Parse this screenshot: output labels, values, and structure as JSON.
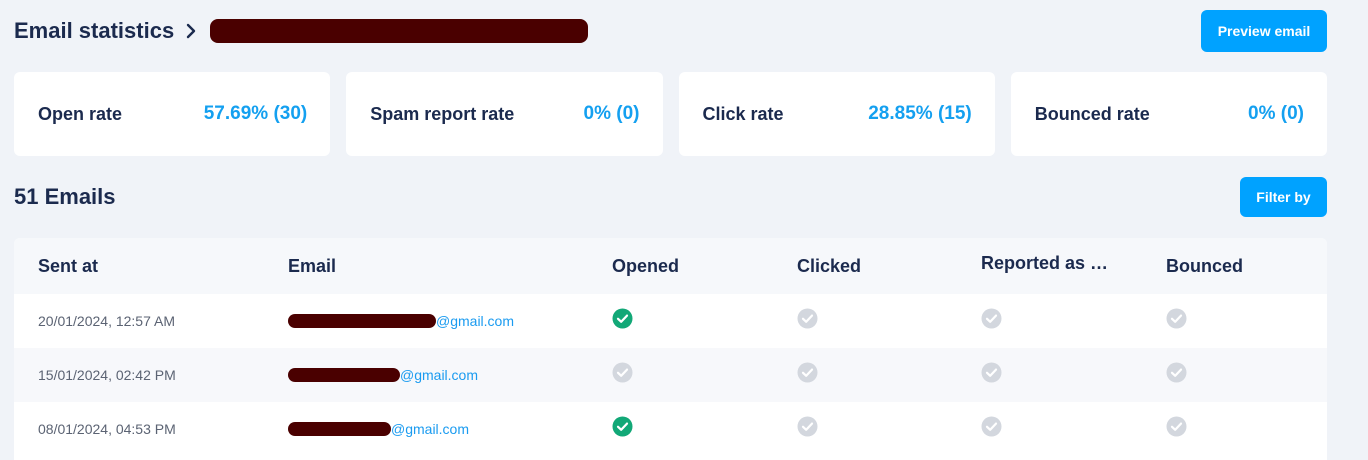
{
  "header": {
    "title": "Email statistics",
    "preview_button": "Preview email"
  },
  "stats": [
    {
      "label": "Open rate",
      "value": "57.69% (30)"
    },
    {
      "label": "Spam report rate",
      "value": "0% (0)"
    },
    {
      "label": "Click rate",
      "value": "28.85% (15)"
    },
    {
      "label": "Bounced rate",
      "value": "0% (0)"
    }
  ],
  "list": {
    "title": "51 Emails",
    "filter_button": "Filter by"
  },
  "table": {
    "columns": [
      "Sent at",
      "Email",
      "Opened",
      "Clicked",
      "Reported as s…",
      "Bounced"
    ],
    "rows": [
      {
        "sent_at": "20/01/2024, 12:57 AM",
        "email_domain": "@gmail.com",
        "opened": true,
        "clicked": false,
        "reported": false,
        "bounced": false
      },
      {
        "sent_at": "15/01/2024, 02:42 PM",
        "email_domain": "@gmail.com",
        "opened": false,
        "clicked": false,
        "reported": false,
        "bounced": false
      },
      {
        "sent_at": "08/01/2024, 04:53 PM",
        "email_domain": "@gmail.com",
        "opened": true,
        "clicked": false,
        "reported": false,
        "bounced": false
      }
    ]
  },
  "colors": {
    "accent": "#00a2ff",
    "stat_value": "#14a0f0",
    "check_on": "#12a877",
    "check_off": "#d3d7de",
    "redaction": "#4a0000"
  },
  "icons": {
    "breadcrumb": "chevron-right-icon",
    "status_yes": "check-circle-filled-icon",
    "status_no": "check-circle-gray-icon"
  }
}
